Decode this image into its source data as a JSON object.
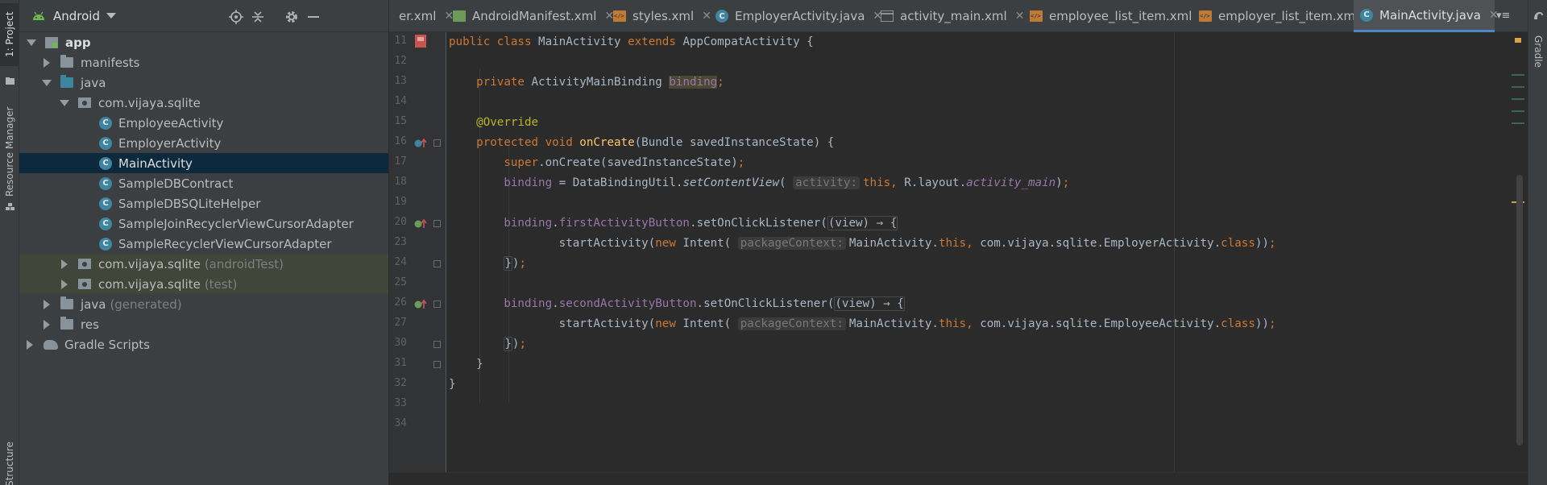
{
  "left_strip": {
    "project_tab": "1: Project",
    "resource_tab": "Resource Manager",
    "structure_tab": "Structure"
  },
  "project_panel": {
    "view_selector": "Android",
    "tree": [
      {
        "label": "app",
        "suffix": "",
        "level": 0,
        "expanded": true,
        "icon": "app-module-icon",
        "bold": true
      },
      {
        "label": "manifests",
        "suffix": "",
        "level": 1,
        "expanded": false,
        "icon": "folder-icon"
      },
      {
        "label": "java",
        "suffix": "",
        "level": 1,
        "expanded": true,
        "icon": "folder-icon"
      },
      {
        "label": "com.vijaya.sqlite",
        "suffix": "",
        "level": 2,
        "expanded": true,
        "icon": "package-icon"
      },
      {
        "label": "EmployeeActivity",
        "suffix": "",
        "level": 3,
        "icon": "class-icon"
      },
      {
        "label": "EmployerActivity",
        "suffix": "",
        "level": 3,
        "icon": "class-icon"
      },
      {
        "label": "MainActivity",
        "suffix": "",
        "level": 3,
        "icon": "class-icon",
        "selected": true
      },
      {
        "label": "SampleDBContract",
        "suffix": "",
        "level": 3,
        "icon": "class-icon"
      },
      {
        "label": "SampleDBSQLiteHelper",
        "suffix": "",
        "level": 3,
        "icon": "class-icon"
      },
      {
        "label": "SampleJoinRecyclerViewCursorAdapter",
        "suffix": "",
        "level": 3,
        "icon": "class-icon"
      },
      {
        "label": "SampleRecyclerViewCursorAdapter",
        "suffix": "",
        "level": 3,
        "icon": "class-icon"
      },
      {
        "label": "com.vijaya.sqlite",
        "suffix": "(androidTest)",
        "level": 2,
        "expanded": false,
        "icon": "package-icon",
        "tested": true
      },
      {
        "label": "com.vijaya.sqlite",
        "suffix": "(test)",
        "level": 2,
        "expanded": false,
        "icon": "package-icon",
        "tested": true
      },
      {
        "label": "java",
        "suffix": "(generated)",
        "level": 1,
        "expanded": false,
        "icon": "generated-folder-icon"
      },
      {
        "label": "res",
        "suffix": "",
        "level": 1,
        "expanded": false,
        "icon": "res-folder-icon"
      },
      {
        "label": "Gradle Scripts",
        "suffix": "",
        "level": 0,
        "expanded": false,
        "icon": "gradle-icon"
      }
    ]
  },
  "tabs": [
    {
      "label": "er.xml",
      "icon": "layout-icon",
      "active": false
    },
    {
      "label": "AndroidManifest.xml",
      "icon": "manifest-icon",
      "active": false
    },
    {
      "label": "styles.xml",
      "icon": "xml-icon",
      "active": false
    },
    {
      "label": "EmployerActivity.java",
      "icon": "class-icon",
      "active": false
    },
    {
      "label": "activity_main.xml",
      "icon": "layout-icon",
      "active": false
    },
    {
      "label": "employee_list_item.xml",
      "icon": "xml-icon",
      "active": false
    },
    {
      "label": "employer_list_item.xml",
      "icon": "xml-icon",
      "active": false
    },
    {
      "label": "MainActivity.java",
      "icon": "class-icon",
      "active": true
    }
  ],
  "editor": {
    "line_numbers": [
      "11",
      "12",
      "13",
      "14",
      "15",
      "16",
      "17",
      "18",
      "19",
      "20",
      "23",
      "24",
      "25",
      "26",
      "27",
      "30",
      "31",
      "32",
      "33",
      "34"
    ],
    "hints": {
      "activity": "activity:",
      "package_context": "packageContext:"
    }
  },
  "right_strip": {
    "gradle_tab": "Gradle"
  },
  "colors": {
    "background": "#2b2b2b",
    "panel": "#3c3f41",
    "selection": "#0d293e",
    "keyword": "#cc7832",
    "annotation": "#bbb529",
    "field": "#9876aa",
    "method": "#ffc66d",
    "text": "#a9b7c6"
  }
}
